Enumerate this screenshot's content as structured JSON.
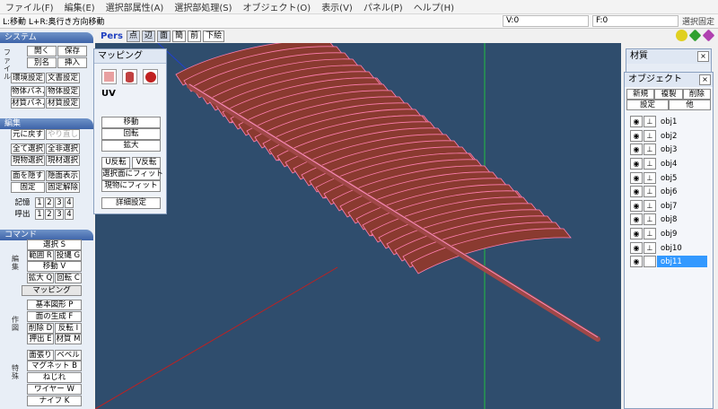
{
  "menubar": [
    "ファイル(F)",
    "編集(E)",
    "選択部属性(A)",
    "選択部処理(S)",
    "オブジェクト(O)",
    "表示(V)",
    "パネル(P)",
    "ヘルプ(H)"
  ],
  "status": {
    "hint": "L:移動  L+R:奥行き方向移動",
    "v": "V:0",
    "f": "F:0",
    "select_lock": "選択固定"
  },
  "view_toolbar": {
    "mode": "Pers",
    "buttons": [
      "点",
      "辺",
      "面",
      "簡",
      "前",
      "下絵"
    ]
  },
  "colors": {
    "viewport_bg": "#2f4d6d",
    "mesh_fill": "#8a3a30",
    "mesh_line": "#ff7fb0",
    "panel_header": "#4a70b0",
    "selected": "#3399ff"
  },
  "system": {
    "title": "システム",
    "side_label": "ファイル",
    "open": "開く",
    "save": "保存",
    "save_as": "別名",
    "insert": "挿入",
    "env_settings": "環境設定",
    "doc_settings": "文書設定",
    "obj_panel": "物体パネル",
    "obj_settings": "物体設定",
    "mat_panel": "材質パネル",
    "mat_settings": "材質設定"
  },
  "edit": {
    "title": "編集",
    "undo": "元に戻す",
    "redo": "やり直し",
    "select_all": "全て選択",
    "deselect_all": "全非選択",
    "select_visible": "現物選択",
    "select_material": "現材選択",
    "hide_face": "面を隠す",
    "show_hidden": "隠面表示",
    "lock": "固定",
    "unlock": "固定解除",
    "memory": "記憶",
    "recall": "呼出",
    "slots": [
      "1",
      "2",
      "3",
      "4"
    ]
  },
  "command": {
    "title": "コマンド",
    "label_edit": "編集",
    "label_create": "作図",
    "label_special": "特殊",
    "select": "選択 S",
    "range": "範囲 R",
    "lasso": "投縄 G",
    "move": "移動 V",
    "scale": "拡大 Q",
    "rotate": "回転 C",
    "mapping": "マッピング",
    "primitive": "基本図形 P",
    "face_gen": "面の生成 F",
    "delete": "削除 D",
    "flip": "反転 I",
    "extrude": "押出 E",
    "material": "材質 M",
    "surface": "面張り",
    "bevel": "ベベル",
    "magnet": "マグネット B",
    "twist": "ねじれ",
    "wire": "ワイヤー W",
    "knife": "ナイフ K"
  },
  "mapping_panel": {
    "title": "マッピング",
    "uv": "UV",
    "move": "移動",
    "rotate": "回転",
    "scale": "拡大",
    "u_flip": "U反転",
    "v_flip": "V反転",
    "fit_selected": "選択面にフィット",
    "fit_object": "現物にフィット",
    "details": "詳細設定"
  },
  "material_window": {
    "title": "材質"
  },
  "object_window": {
    "title": "オブジェクト",
    "new": "新規",
    "copy": "複製",
    "delete": "削除",
    "settings": "設定",
    "other": "他",
    "objects": [
      "obj1",
      "obj2",
      "obj3",
      "obj4",
      "obj5",
      "obj6",
      "obj7",
      "obj8",
      "obj9",
      "obj10",
      "obj11"
    ],
    "selected_index": 10
  }
}
